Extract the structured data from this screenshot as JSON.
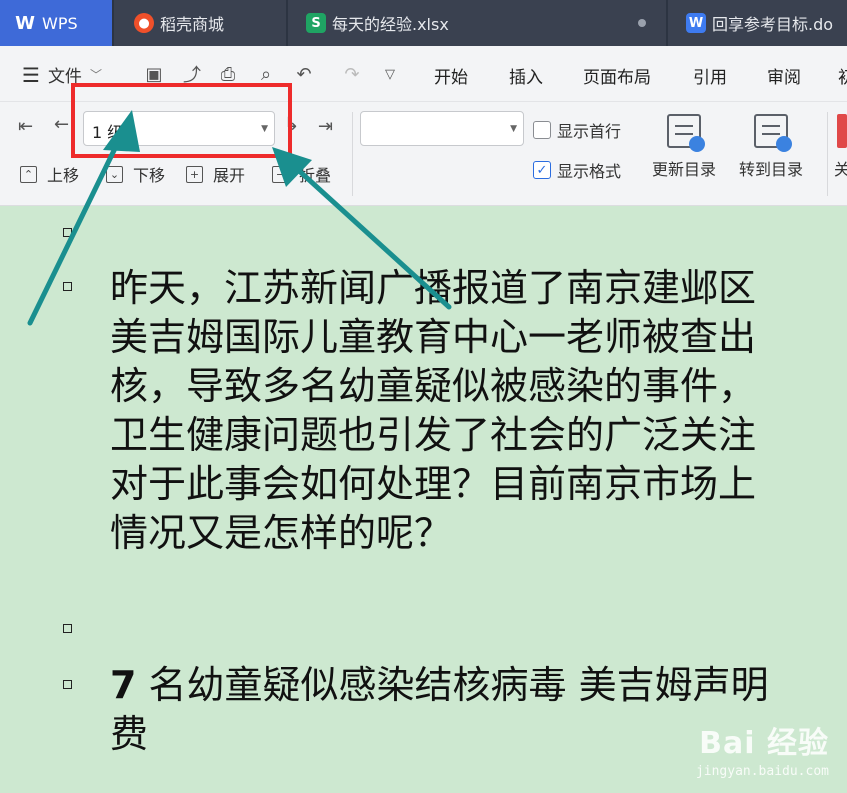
{
  "tabs": [
    {
      "icon": "wps-logo-icon",
      "label": "WPS"
    },
    {
      "icon": "daoke-store-icon",
      "label": "稻壳商城"
    },
    {
      "icon": "spreadsheet-icon",
      "label": "每天的经验.xlsx"
    },
    {
      "icon": "word-doc-icon",
      "label": "回享参考目标.do"
    }
  ],
  "menu": {
    "file_label": "文件",
    "tabs": [
      "开始",
      "插入",
      "页面布局",
      "引用",
      "审阅",
      "初"
    ]
  },
  "ribbon": {
    "level_value": "1 级",
    "move_up": "上移",
    "move_down": "下移",
    "expand": "展开",
    "collapse": "折叠",
    "show_first_line": "显示首行",
    "show_format": "显示格式",
    "update_toc": "更新目录",
    "goto_toc": "转到目录",
    "close_partial": "关"
  },
  "document": {
    "paragraph1": [
      "昨天，江苏新闻广播报道了南京建邺区",
      "美吉姆国际儿童教育中心一老师被查出",
      "核，导致多名幼童疑似被感染的事件，",
      "卫生健康问题也引发了社会的广泛关注",
      "对于此事会如何处理？目前南京市场上",
      "情况又是怎样的呢？"
    ],
    "heading_number": "7",
    "heading_line1": " 名幼童疑似感染结核病毒 美吉姆声明",
    "heading_line2": "费"
  },
  "watermark": {
    "logo": "Bai 经验",
    "url": "jingyan.baidu.com"
  },
  "colors": {
    "doc_background": "#cde8d0",
    "highlight_box": "#ee2b2b",
    "arrow": "#1a8f8f",
    "tabbar": "#2c3442",
    "active_tab": "#3e6ad8"
  }
}
